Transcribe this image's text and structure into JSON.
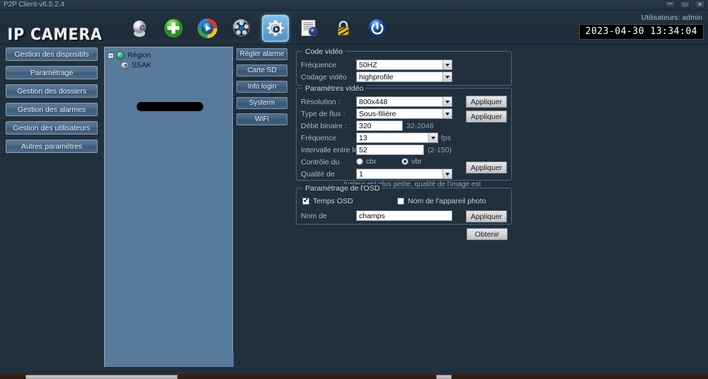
{
  "window": {
    "title": "P2P Client-v6.5.2.4",
    "controls": [
      {
        "name": "minimize",
        "glyph": "–"
      },
      {
        "name": "maximize",
        "glyph": "▭"
      },
      {
        "name": "close",
        "glyph": "✕"
      }
    ]
  },
  "header": {
    "brand": "IP CAMERA",
    "user_label": "Utilisateurs: admin",
    "datetime": "2023-04-30 13:34:04",
    "toolbar": [
      {
        "icon": "camera-icon",
        "selected": false
      },
      {
        "icon": "add-device-icon",
        "selected": false
      },
      {
        "icon": "playback-icon",
        "selected": false
      },
      {
        "icon": "film-reel-icon",
        "selected": false
      },
      {
        "icon": "settings-gear-icon",
        "selected": true
      },
      {
        "icon": "log-settings-icon",
        "selected": false
      },
      {
        "icon": "lock-icon",
        "selected": false
      },
      {
        "icon": "power-icon",
        "selected": false
      }
    ]
  },
  "sidebar": {
    "items": [
      {
        "label": "Gestion des dispositifs"
      },
      {
        "label": "Paramétrage"
      },
      {
        "label": "Gestion des dossiers"
      },
      {
        "label": "Gestion des alarmes"
      },
      {
        "label": "Gestion des utilisateurs"
      },
      {
        "label": "Autres paramètres"
      }
    ]
  },
  "tree": {
    "root": {
      "label": "Région",
      "expander": "−"
    },
    "child": {
      "label": "SSAK"
    }
  },
  "midbuttons": {
    "items": [
      {
        "label": "Régler alarme"
      },
      {
        "label": "Carte SD"
      },
      {
        "label": "Info login"
      },
      {
        "label": "Systerm"
      },
      {
        "label": "WiFi"
      }
    ]
  },
  "video_code": {
    "legend": "Code vidéo",
    "frequency_label": "Fréquence",
    "frequency_value": "50HZ",
    "encoding_label": "Codage vidéo",
    "encoding_value": "highprofile",
    "apply_label": "Appliquer"
  },
  "video_params": {
    "legend": "Paramètres vidéo",
    "resolution_label": "Résolution :",
    "resolution_value": "800x448",
    "stream_label": "Type de flux :",
    "stream_value": "Sous-filière",
    "bitrate_label": "Débit binaire :",
    "bitrate_value": "320",
    "bitrate_range": "32-2048",
    "framerate_label": "Fréquence",
    "framerate_value": "13",
    "framerate_unit": "fps",
    "interval_label": "Intervalle entre les",
    "interval_value": "52",
    "interval_range": "(2-150)",
    "control_label": "Contrôle du",
    "control_cbr": "cbr",
    "control_vbr": "vbr",
    "control_selected": "vbr",
    "quality_label": "Qualité de",
    "quality_value": "1",
    "quality_hint": "(valeur est plus petite, qualité de l'image est",
    "apply_top_label": "Appliquer",
    "apply_bottom_label": "Appliquer"
  },
  "osd": {
    "legend": "Paramétrage de l'OSD",
    "time_osd_label": "Temps OSD",
    "time_osd_checked": true,
    "camera_name_label": "Nom de l'appareil photo",
    "camera_name_checked": false,
    "name_label": "Nom de",
    "name_value": "champs",
    "apply_label": "Appliquer"
  },
  "footer": {
    "get_label": "Obtenir"
  }
}
